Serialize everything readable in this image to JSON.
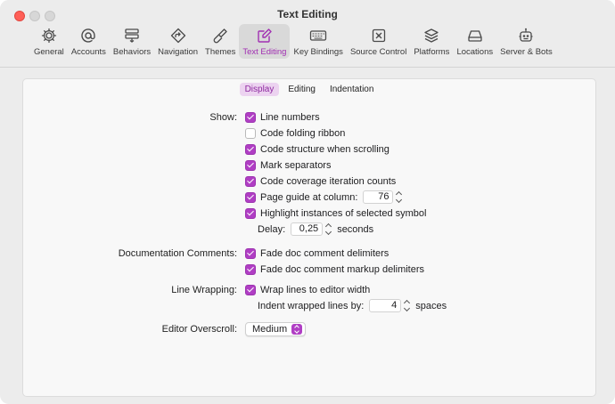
{
  "window": {
    "title": "Text Editing"
  },
  "toolbar": {
    "items": [
      {
        "label": "General",
        "icon": "gear-icon"
      },
      {
        "label": "Accounts",
        "icon": "at-sign-icon"
      },
      {
        "label": "Behaviors",
        "icon": "behaviors-icon"
      },
      {
        "label": "Navigation",
        "icon": "navigation-icon"
      },
      {
        "label": "Themes",
        "icon": "paintbrush-icon"
      },
      {
        "label": "Text Editing",
        "icon": "pencil-square-icon",
        "active": true
      },
      {
        "label": "Key Bindings",
        "icon": "keyboard-icon"
      },
      {
        "label": "Source Control",
        "icon": "source-control-icon"
      },
      {
        "label": "Platforms",
        "icon": "layers-icon"
      },
      {
        "label": "Locations",
        "icon": "drive-icon"
      },
      {
        "label": "Server & Bots",
        "icon": "robot-icon"
      }
    ]
  },
  "tabs": [
    {
      "label": "Display",
      "active": true
    },
    {
      "label": "Editing"
    },
    {
      "label": "Indentation"
    }
  ],
  "show": {
    "label": "Show:",
    "line_numbers": {
      "label": "Line numbers",
      "checked": true
    },
    "code_folding": {
      "label": "Code folding ribbon",
      "checked": false
    },
    "code_structure": {
      "label": "Code structure when scrolling",
      "checked": true
    },
    "mark_separators": {
      "label": "Mark separators",
      "checked": true
    },
    "code_coverage": {
      "label": "Code coverage iteration counts",
      "checked": true
    },
    "page_guide": {
      "label": "Page guide at column:",
      "checked": true,
      "value": "76"
    },
    "highlight": {
      "label": "Highlight instances of selected symbol",
      "checked": true
    },
    "delay": {
      "label": "Delay:",
      "value": "0,25",
      "unit": "seconds"
    }
  },
  "doc_comments": {
    "label": "Documentation Comments:",
    "fade_delimiters": {
      "label": "Fade doc comment delimiters",
      "checked": true
    },
    "fade_markup": {
      "label": "Fade doc comment markup delimiters",
      "checked": true
    }
  },
  "line_wrapping": {
    "label": "Line Wrapping:",
    "wrap": {
      "label": "Wrap lines to editor width",
      "checked": true
    },
    "indent": {
      "label": "Indent wrapped lines by:",
      "value": "4",
      "unit": "spaces"
    }
  },
  "overscroll": {
    "label": "Editor Overscroll:",
    "value": "Medium"
  },
  "colors": {
    "accent": "#b03ec4",
    "active_tab_bg": "#ecd3f0"
  }
}
